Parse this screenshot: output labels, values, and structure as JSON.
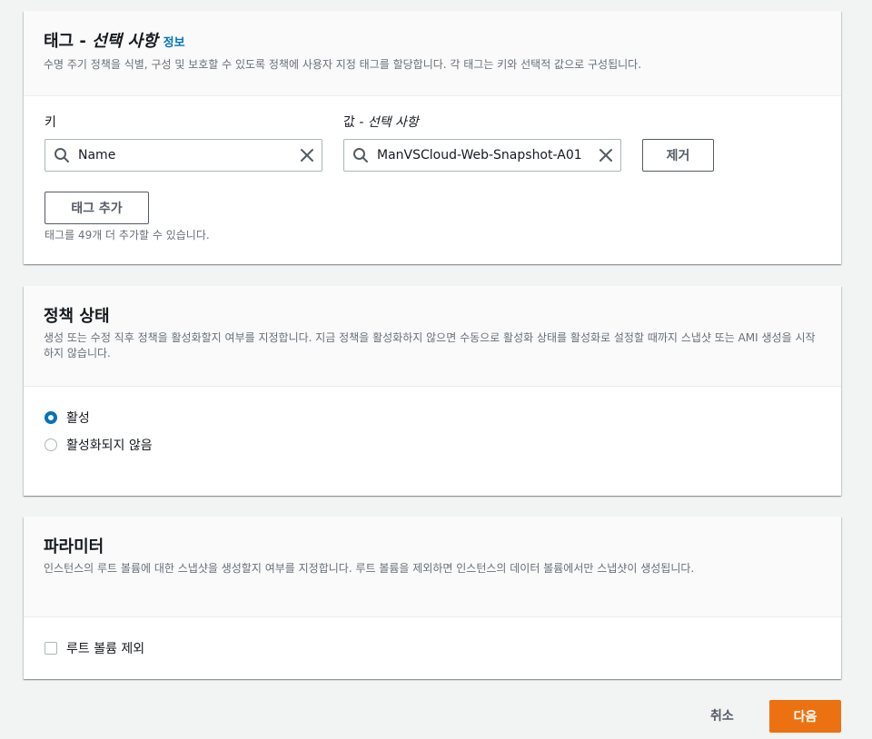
{
  "tags": {
    "title_prefix": "태그 - ",
    "title_optional": "선택 사항",
    "info_link": "정보",
    "description": "수명 주기 정책을 식별, 구성 및 보호할 수 있도록 정책에 사용자 지정 태그를 할당합니다. 각 태그는 키와 선택적 값으로 구성됩니다.",
    "key_label": "키",
    "value_label_prefix": "값 - ",
    "value_label_optional": "선택 사항",
    "key_value": "Name",
    "value_value": "ManVSCloud-Web-Snapshot-A01",
    "remove_button": "제거",
    "add_tag_button": "태그 추가",
    "remaining_hint": "태그를 49개 더 추가할 수 있습니다."
  },
  "policy_status": {
    "title": "정책 상태",
    "description": "생성 또는 수정 직후 정책을 활성화할지 여부를 지정합니다. 지금 정책을 활성화하지 않으면 수동으로 활성화 상태를 활성화로 설정할 때까지 스냅샷 또는 AMI 생성을 시작하지 않습니다.",
    "options": [
      {
        "label": "활성",
        "selected": true
      },
      {
        "label": "활성화되지 않음",
        "selected": false
      }
    ]
  },
  "parameters": {
    "title": "파라미터",
    "description": "인스턴스의 루트 볼륨에 대한 스냅샷을 생성할지 여부를 지정합니다. 루트 볼륨을 제외하면 인스턴스의 데이터 볼륨에서만 스냅샷이 생성됩니다.",
    "exclude_root_label": "루트 볼륨 제외",
    "exclude_root_checked": false
  },
  "footer": {
    "cancel_label": "취소",
    "next_label": "다음"
  },
  "colors": {
    "accent": "#0073bb",
    "primary_button": "#ec7211",
    "background": "#f2f3f3"
  },
  "icons": {
    "search": "search-icon",
    "clear": "close-icon"
  }
}
